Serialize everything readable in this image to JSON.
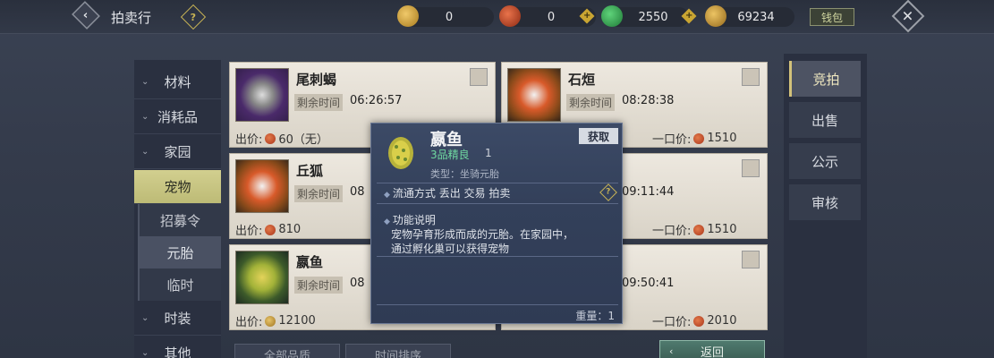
{
  "header": {
    "back_icon": "back-arrow-icon",
    "title": "拍卖行",
    "help_icon": "question-diamond-icon",
    "currencies": [
      {
        "icon": "gold-bell-icon",
        "value": "0"
      },
      {
        "icon": "red-swirl-coin-icon",
        "value": "0"
      },
      {
        "icon": "green-jade-icon",
        "value": "2550"
      },
      {
        "icon": "gold-leaf-coin-icon",
        "value": "69234"
      }
    ],
    "wallet_label": "钱包",
    "close_icon": "close-x-icon"
  },
  "sidebar": {
    "items": [
      {
        "label": "材料"
      },
      {
        "label": "消耗品"
      },
      {
        "label": "家园"
      },
      {
        "label": "宠物"
      },
      {
        "label": "招募令"
      },
      {
        "label": "元胎"
      },
      {
        "label": "临时"
      },
      {
        "label": "时装"
      },
      {
        "label": "其他"
      }
    ]
  },
  "cards": [
    {
      "name": "尾刺蝎",
      "time_label": "剩余时间",
      "time": "06:26:57",
      "price_label": "出价:",
      "price": "60（无）",
      "buy_label": "",
      "buy_price": ""
    },
    {
      "name": "石烜",
      "time_label": "剩余时间",
      "time": "08:28:38",
      "price_label": "",
      "price": "",
      "buy_label": "一口价:",
      "buy_price": "1510"
    },
    {
      "name": "丘狐",
      "time_label": "剩余时间",
      "time": "08",
      "price_label": "出价:",
      "price": "810",
      "buy_label": "",
      "buy_price": ""
    },
    {
      "name": "",
      "time_label": "",
      "time": "09:11:44",
      "price_label": "",
      "price": "",
      "buy_label": "一口价:",
      "buy_price": "1510"
    },
    {
      "name": "嬴鱼",
      "time_label": "剩余时间",
      "time": "08",
      "price_label": "出价:",
      "price": "12100",
      "buy_label": "",
      "buy_price": ""
    },
    {
      "name": "",
      "time_label": "",
      "time": "09:50:41",
      "price_label": "",
      "price": "",
      "buy_label": "一口价:",
      "buy_price": "2010"
    }
  ],
  "right_tabs": [
    {
      "label": "竞拍"
    },
    {
      "label": "出售"
    },
    {
      "label": "公示"
    },
    {
      "label": "审核"
    }
  ],
  "bottom": {
    "quality_label": "全部品质",
    "sort_label": "时间排序",
    "return_label": "返回"
  },
  "tooltip": {
    "name": "嬴鱼",
    "quality": "3品精良",
    "count": "1",
    "type": "类型：坐骑元胎",
    "obtain_label": "获取",
    "circulation": "流通方式    丢出 交易 拍卖",
    "function_title": "功能说明",
    "desc_line1": "宠物孕育形成而成的元胎。在家园中，",
    "desc_line2": "通过孵化巢可以获得宠物",
    "weight": "重量：1"
  },
  "colors": {
    "accent_gold": "#d3c27a",
    "card_bg": "#e6e0d5",
    "quality_green": "#6fd8a0"
  }
}
